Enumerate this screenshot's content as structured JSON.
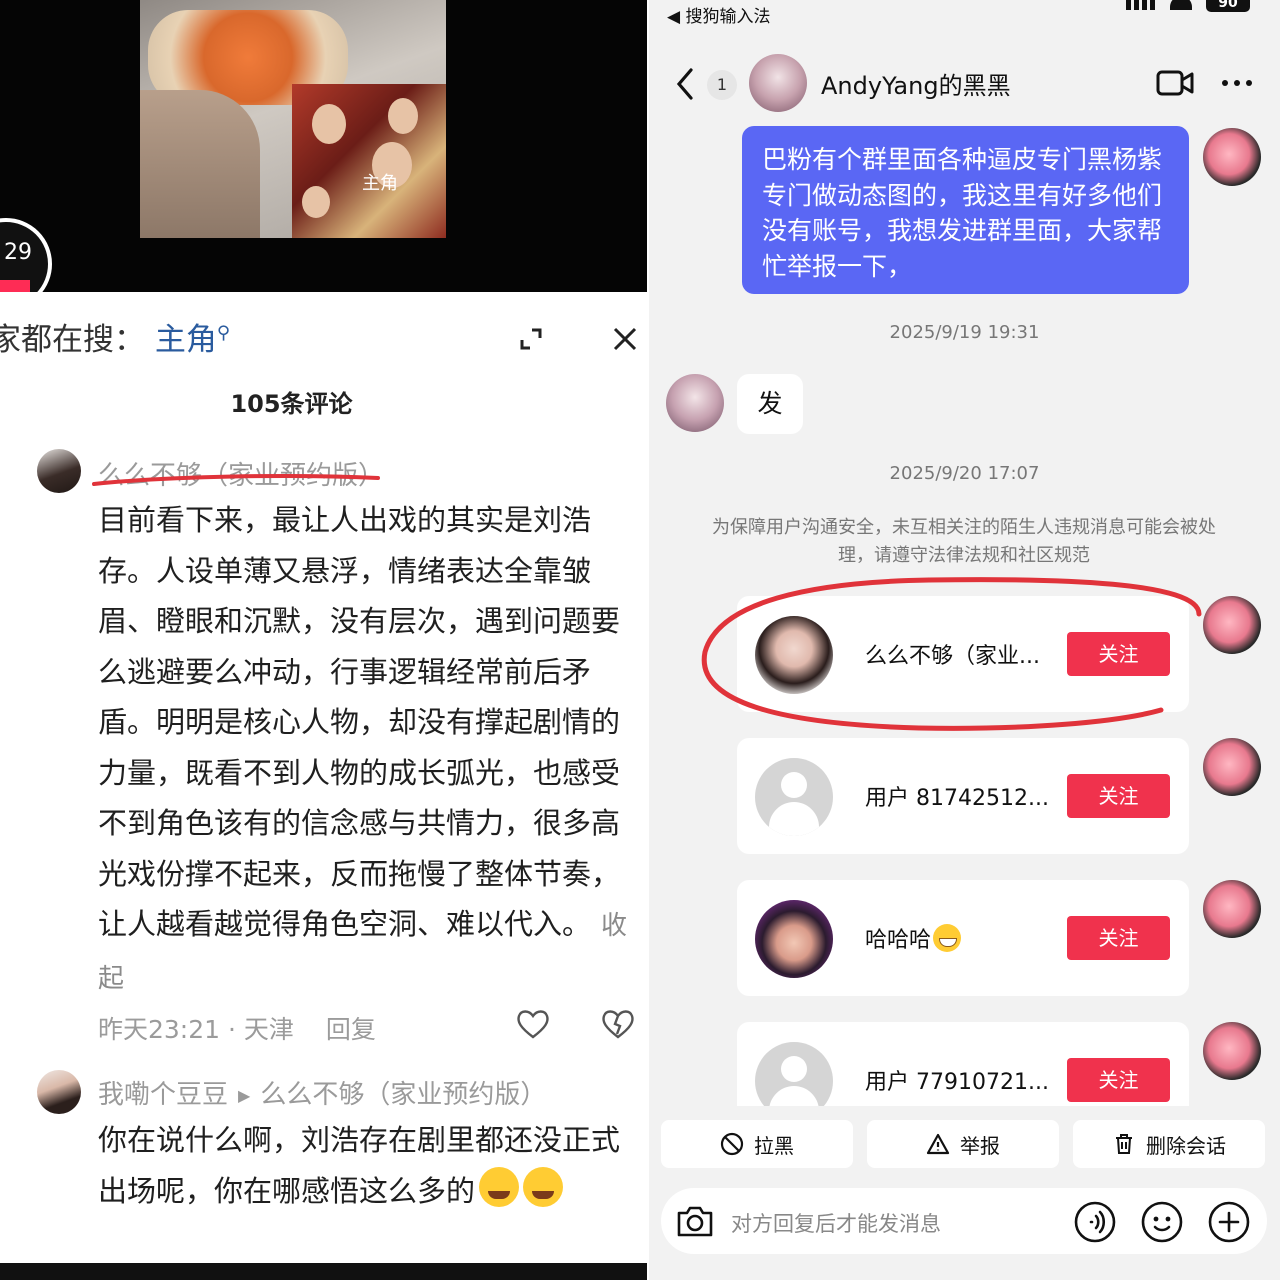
{
  "left": {
    "badge_number": "29",
    "hot_search_label": "家都在搜：",
    "hot_search_keyword": "主角",
    "comment_count": "105条评论",
    "comments": [
      {
        "author": "么么不够（家业预约版）",
        "body": "目前看下来，最让人出戏的其实是刘浩存。人设单薄又悬浮，情绪表达全靠皱眉、瞪眼和沉默，没有层次，遇到问题要么逃避要么冲动，行事逻辑经常前后矛盾。明明是核心人物，却没有撑起剧情的力量，既看不到人物的成长弧光，也感受不到角色该有的信念感与共情力，很多高光戏份撑不起来，反而拖慢了整体节奏，让人越看越觉得角色空洞、难以代入。",
        "fold_label": "收起",
        "meta": "昨天23:21 · 天津",
        "reply_label": "回复"
      },
      {
        "author": "我嘞个豆豆",
        "reply_to": "么么不够（家业预约版）",
        "body": "你在说什么啊，刘浩存在剧里都还没正式出场呢，你在哪感悟这么多的"
      }
    ],
    "poster_text": "主角"
  },
  "right": {
    "status": {
      "back_app": "◀ 搜狗输入法",
      "battery": "90"
    },
    "header": {
      "unread": "1",
      "name": "AndyYang的黑黑"
    },
    "messages": {
      "mine": "巴粉有个群里面各种逼皮专门黑杨紫专门做动态图的，我这里有好多他们没有账号，我想发进群里面，大家帮忙举报一下，",
      "ts1": "2025/9/19 19:31",
      "theirs": "发",
      "ts2": "2025/9/20 17:07",
      "notice": "为保障用户沟通安全，未互相关注的陌生人违规消息可能会被处理，请遵守法律法规和社区规范"
    },
    "cards": [
      {
        "name": "么么不够（家业...",
        "follow": "关注",
        "avatar": "woman-avatar"
      },
      {
        "name": "用户 81742512...",
        "follow": "关注",
        "avatar": "default-avatar"
      },
      {
        "name": "哈哈哈",
        "follow": "关注",
        "avatar": "costume-avatar"
      },
      {
        "name": "用户 77910721...",
        "follow": "关注",
        "avatar": "default-avatar"
      }
    ],
    "actions": {
      "block": "拉黑",
      "report": "举报",
      "delete": "删除会话"
    },
    "input_placeholder": "对方回复后才能发消息",
    "colors": {
      "accent_blue": "#5a67f4",
      "follow_red": "#f0324d",
      "annotation_red": "#e0333a"
    }
  }
}
